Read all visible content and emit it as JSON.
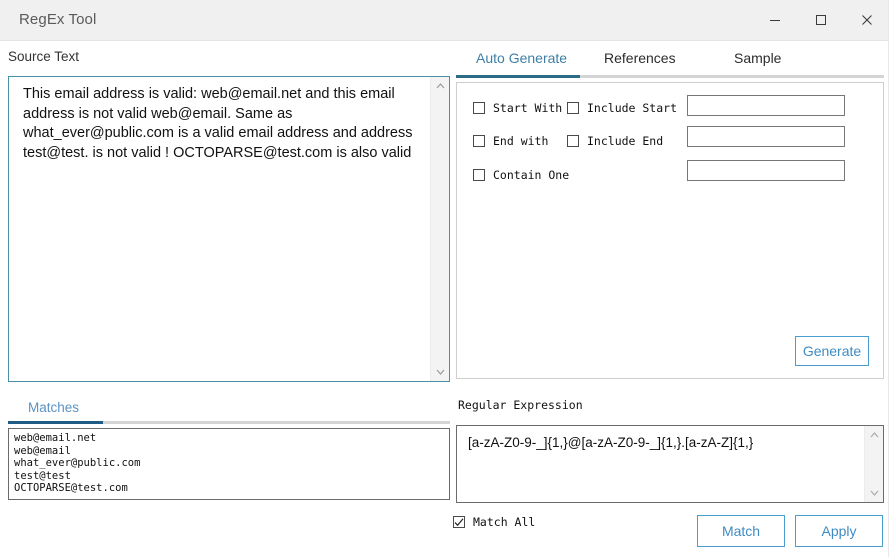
{
  "window": {
    "title": "RegEx Tool",
    "controls": {
      "minimize": "minimize-icon",
      "maximize": "maximize-icon",
      "close": "close-icon"
    }
  },
  "source": {
    "label": "Source Text",
    "value": "This email address is valid: web@email.net and this email address is not valid web@email. Same as what_ever@public.com is a valid email address and address test@test. is not valid ! OCTOPARSE@test.com is also valid"
  },
  "tabs": [
    {
      "id": "auto-generate",
      "label": "Auto Generate",
      "active": true
    },
    {
      "id": "references",
      "label": "References",
      "active": false
    },
    {
      "id": "sample",
      "label": "Sample",
      "active": false
    }
  ],
  "auto_generate": {
    "checkboxes": [
      {
        "id": "start-with",
        "label": "Start With",
        "checked": false
      },
      {
        "id": "end-with",
        "label": "End with",
        "checked": false
      },
      {
        "id": "contain-one",
        "label": "Contain One",
        "checked": false
      },
      {
        "id": "include-start",
        "label": "Include Start",
        "checked": false
      },
      {
        "id": "include-end",
        "label": "Include End",
        "checked": false
      }
    ],
    "inputs": [
      {
        "id": "start-with-input",
        "value": "",
        "placeholder": ""
      },
      {
        "id": "end-with-input",
        "value": "",
        "placeholder": ""
      },
      {
        "id": "contain-one-input",
        "value": "",
        "placeholder": ""
      }
    ],
    "generate_label": "Generate"
  },
  "matches": {
    "tab_label": "Matches",
    "items": [
      "web@email.net",
      "web@email",
      "what_ever@public.com",
      "test@test",
      "OCTOPARSE@test.com"
    ]
  },
  "regex": {
    "label": "Regular Expression",
    "value": "[a-zA-Z0-9-_]{1,}@[a-zA-Z0-9-_]{1,}.[a-zA-Z]{1,}"
  },
  "footer": {
    "match_all": {
      "label": "Match All",
      "checked": true
    },
    "match_label": "Match",
    "apply_label": "Apply"
  },
  "colors": {
    "titlebar_bg": "#f0f0f0",
    "accent_tab": "#2b6b86",
    "accent_matches": "#1f5d86",
    "button_border": "#4a9ed0",
    "button_text": "#3f8cc4",
    "source_border": "#4a90a4"
  }
}
